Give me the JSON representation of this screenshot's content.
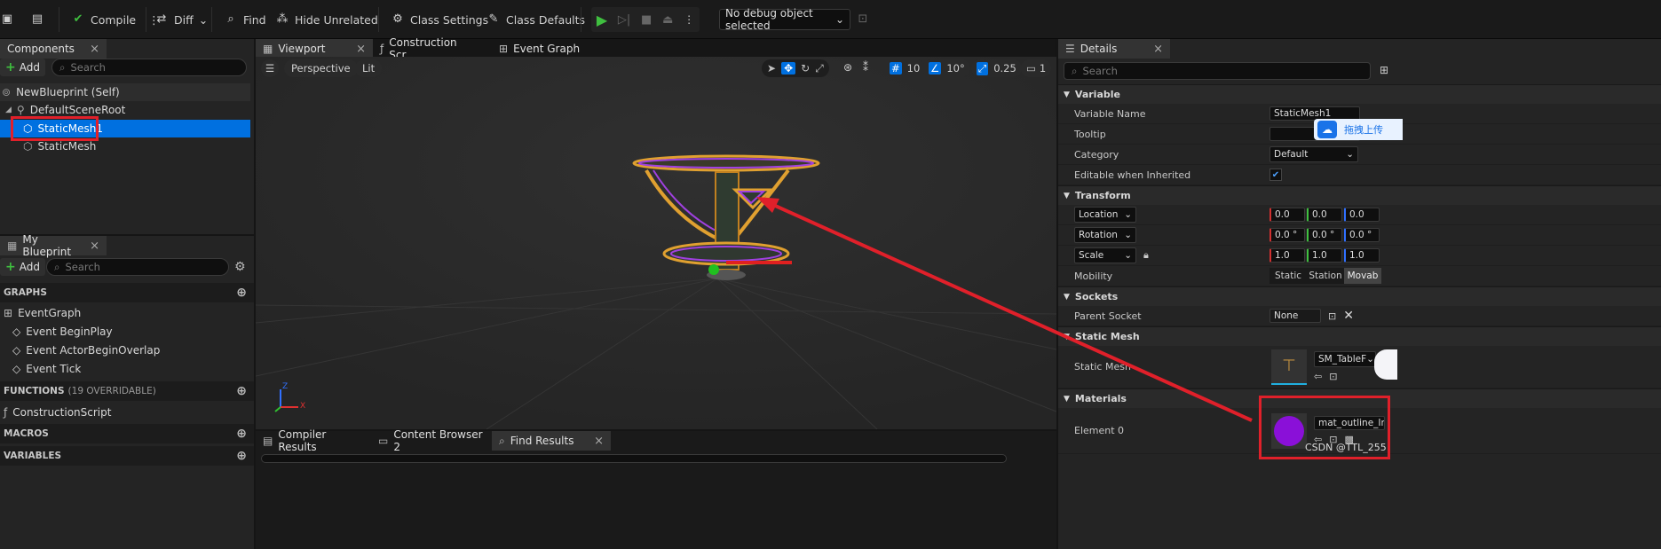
{
  "toolbar": {
    "compile": "Compile",
    "diff": "Diff",
    "find": "Find",
    "hide_unrelated": "Hide Unrelated",
    "class_settings": "Class Settings",
    "class_defaults": "Class Defaults",
    "debug_object": "No debug object selected"
  },
  "components": {
    "tab": "Components",
    "add": "Add",
    "search_placeholder": "Search",
    "root": "NewBlueprint (Self)",
    "scene_root": "DefaultSceneRoot",
    "items": [
      "StaticMesh1",
      "StaticMesh"
    ]
  },
  "my_blueprint": {
    "tab": "My Blueprint",
    "add": "Add",
    "search_placeholder": "Search",
    "graphs_label": "GRAPHS",
    "event_graph": "EventGraph",
    "events": [
      "Event BeginPlay",
      "Event ActorBeginOverlap",
      "Event Tick"
    ],
    "functions_label": "FUNCTIONS",
    "functions_note": "(19 OVERRIDABLE)",
    "construction_script": "ConstructionScript",
    "macros_label": "MACROS",
    "variables_label": "VARIABLES"
  },
  "viewport": {
    "tabs": [
      "Viewport",
      "Construction Scr...",
      "Event Graph"
    ],
    "perspective": "Perspective",
    "lit": "Lit",
    "grid_snap": "10",
    "rotation_snap": "10°",
    "scale_snap": "0.25",
    "camera_speed": "1",
    "axis_x": "X",
    "axis_z": "Z"
  },
  "bottom_tabs": [
    "Compiler Results",
    "Content Browser 2",
    "Find Results"
  ],
  "details": {
    "tab": "Details",
    "search_placeholder": "Search",
    "sections": {
      "variable": "Variable",
      "transform": "Transform",
      "sockets": "Sockets",
      "static_mesh": "Static Mesh",
      "materials": "Materials"
    },
    "variable_name_label": "Variable Name",
    "variable_name_value": "StaticMesh1",
    "tooltip_label": "Tooltip",
    "category_label": "Category",
    "category_value": "Default",
    "editable_label": "Editable when Inherited",
    "location_label": "Location",
    "location": [
      "0.0",
      "0.0",
      "0.0"
    ],
    "rotation_label": "Rotation",
    "rotation": [
      "0.0 °",
      "0.0 °",
      "0.0 °"
    ],
    "scale_label": "Scale",
    "scale": [
      "1.0",
      "1.0",
      "1.0"
    ],
    "mobility_label": "Mobility",
    "mobility_options": [
      "Static",
      "Station",
      "Movab"
    ],
    "parent_socket_label": "Parent Socket",
    "parent_socket_value": "None",
    "static_mesh_label": "Static Mesh",
    "static_mesh_value": "SM_TableF",
    "element0_label": "Element 0",
    "element0_value": "mat_outline_Inst",
    "upload_badge": "拖拽上传"
  },
  "watermark": "CSDN @TTL_255",
  "colors": {
    "selection": "#0070e0",
    "highlight_red": "#e0202a",
    "material_purple": "#8a10d8",
    "accent_green": "#3fbf3f"
  }
}
